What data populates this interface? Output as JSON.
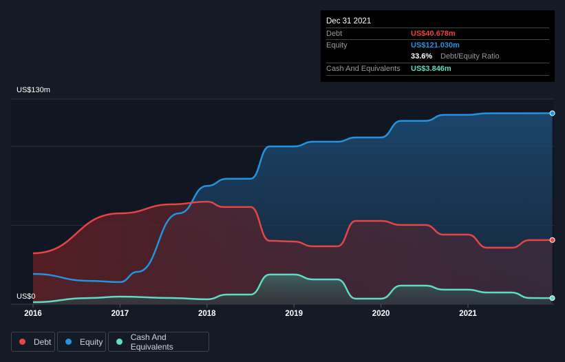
{
  "tooltip": {
    "date": "Dec 31 2021",
    "debt_label": "Debt",
    "debt_value": "US$40.678m",
    "equity_label": "Equity",
    "equity_value": "US$121.030m",
    "ratio_value": "33.6%",
    "ratio_label": "Debt/Equity Ratio",
    "cash_label": "Cash And Equivalents",
    "cash_value": "US$3.846m"
  },
  "colors": {
    "debt": "#e64545",
    "equity": "#2394df",
    "cash": "#5fdcc6"
  },
  "chart_data": {
    "type": "area",
    "ylim": [
      0,
      130
    ],
    "yticks": [
      "US$0",
      "US$130m"
    ],
    "xticks": [
      "2016",
      "2017",
      "2018",
      "2019",
      "2020",
      "2021"
    ],
    "legend": [
      "Debt",
      "Equity",
      "Cash And Equivalents"
    ],
    "series": [
      {
        "name": "Equity",
        "x": [
          2016,
          2016.65,
          2017,
          2017.2,
          2017.68,
          2018,
          2018.23,
          2018.5,
          2018.72,
          2019,
          2019.22,
          2019.5,
          2019.71,
          2020,
          2020.23,
          2020.51,
          2020.72,
          2021,
          2021.22,
          2021.97
        ],
        "values": [
          19.2,
          14.8,
          14,
          20.5,
          57.6,
          75,
          79.5,
          79.5,
          100,
          100,
          103,
          103,
          105.7,
          105.7,
          116.2,
          116.2,
          120,
          120,
          121,
          121.03
        ]
      },
      {
        "name": "Debt",
        "x": [
          2016,
          2017,
          2017.6,
          2018,
          2018.19,
          2018.5,
          2018.72,
          2019,
          2019.22,
          2019.5,
          2019.71,
          2020,
          2020.23,
          2020.51,
          2020.72,
          2021,
          2021.22,
          2021.5,
          2021.71,
          2021.97
        ],
        "values": [
          32.3,
          57.6,
          63.3,
          65,
          61.6,
          61.6,
          40.2,
          39.7,
          36.7,
          36.7,
          52.8,
          52.8,
          50.2,
          50.2,
          44.1,
          44.1,
          35.8,
          35.8,
          40.6,
          40.678
        ]
      },
      {
        "name": "Cash And Equivalents",
        "x": [
          2016,
          2016.65,
          2017,
          2017.6,
          2018,
          2018.23,
          2018.5,
          2018.72,
          2019,
          2019.22,
          2019.5,
          2019.71,
          2020,
          2020.23,
          2020.51,
          2020.72,
          2021,
          2021.22,
          2021.5,
          2021.71,
          2021.97
        ],
        "values": [
          1.3,
          3.9,
          4.8,
          3.9,
          3.1,
          6.1,
          6.1,
          18.8,
          18.8,
          15.7,
          15.7,
          3.5,
          3.5,
          11.8,
          11.8,
          9.2,
          9.2,
          7.4,
          7.4,
          3.9,
          3.846
        ]
      }
    ]
  }
}
